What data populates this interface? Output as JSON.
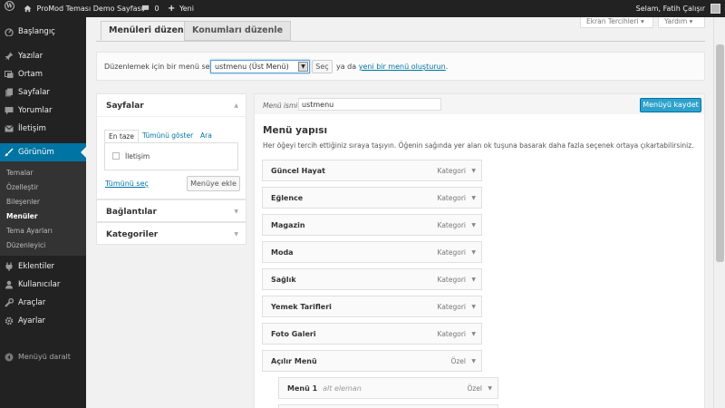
{
  "admin_bar": {
    "site_name": "ProMod Teması Demo Sayfası",
    "comments_count": "0",
    "new_label": "Yeni",
    "greeting": "Selam, Fatih Çalışır"
  },
  "sidebar": {
    "items": [
      {
        "label": "Başlangıç",
        "icon": "dashboard-icon"
      },
      {
        "label": "Yazılar",
        "icon": "pin-icon"
      },
      {
        "label": "Ortam",
        "icon": "media-icon"
      },
      {
        "label": "Sayfalar",
        "icon": "pages-icon"
      },
      {
        "label": "Yorumlar",
        "icon": "comments-icon"
      },
      {
        "label": "İletişim",
        "icon": "mail-icon"
      },
      {
        "label": "Görünüm",
        "icon": "appearance-icon"
      },
      {
        "label": "Eklentiler",
        "icon": "plugins-icon"
      },
      {
        "label": "Kullanıcılar",
        "icon": "users-icon"
      },
      {
        "label": "Araçlar",
        "icon": "tools-icon"
      },
      {
        "label": "Ayarlar",
        "icon": "settings-icon"
      }
    ],
    "submenu": [
      "Temalar",
      "Özelleştir",
      "Bileşenler",
      "Menüler",
      "Tema Ayarları",
      "Düzenleyici"
    ],
    "collapse_label": "Menüyü daralt"
  },
  "screen_options": {
    "screen_label": "Ekran Tercihleri",
    "help_label": "Yardım"
  },
  "tabs": {
    "edit_menus": "Menüleri düzenle",
    "manage_locations": "Konumları düzenle"
  },
  "manage": {
    "select_label": "Düzenlemek için bir menü seçin:",
    "selected_menu": "ustmenu (Üst Menü)",
    "select_button": "Seç",
    "or_text": "ya da",
    "create_link": "yeni bir menü oluşturun",
    "period": "."
  },
  "pages_box": {
    "title": "Sayfalar",
    "tabs": [
      "En taze",
      "Tümünü göster",
      "Ara"
    ],
    "page_item": "İletişim",
    "select_all": "Tümünü seç",
    "add_button": "Menüye ekle"
  },
  "links_box": {
    "title": "Bağlantılar"
  },
  "categories_box": {
    "title": "Kategoriler"
  },
  "menu_editor": {
    "name_label": "Menü ismi",
    "name_value": "ustmenu",
    "save_button": "Menüyü kaydet",
    "structure_title": "Menü yapısı",
    "instructions": "Her öğeyi tercih ettiğiniz sıraya taşıyın. Öğenin sağında yer alan ok tuşuna basarak daha fazla seçenek ortaya çıkartabilirsiniz."
  },
  "menu_items": [
    {
      "title": "Güncel Hayat",
      "type": "Kategori"
    },
    {
      "title": "Eğlence",
      "type": "Kategori"
    },
    {
      "title": "Magazin",
      "type": "Kategori"
    },
    {
      "title": "Moda",
      "type": "Kategori"
    },
    {
      "title": "Sağlık",
      "type": "Kategori"
    },
    {
      "title": "Yemek Tarifleri",
      "type": "Kategori"
    },
    {
      "title": "Foto Galeri",
      "type": "Kategori"
    },
    {
      "title": "Açılır Menü",
      "type": "Özel"
    }
  ],
  "sub_item": {
    "title": "Menü 1",
    "subtitle": "alt eleman",
    "type": "Özel"
  },
  "colors": {
    "admin_dark": "#222222",
    "accent_blue": "#0074a2",
    "save_button_blue": "#2ea2cc",
    "background": "#f1f1f1"
  }
}
